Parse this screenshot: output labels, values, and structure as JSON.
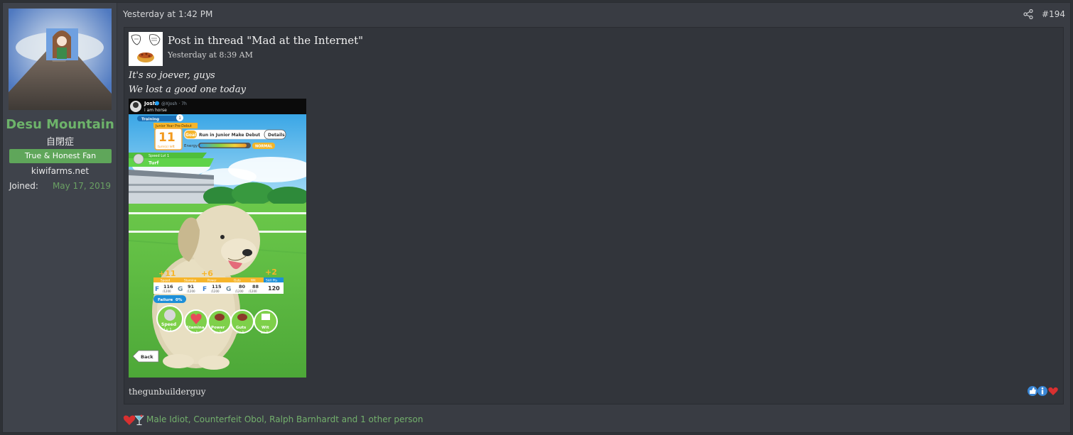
{
  "post": {
    "time": "Yesterday at 1:42 PM",
    "number": "#194",
    "share_icon": "share-icon"
  },
  "user": {
    "name": "Desu Mountain",
    "title": "自閉症",
    "banner": "True & Honest Fan",
    "site": "kiwifarms.net",
    "joined_label": "Joined:",
    "joined_value": "May 17, 2019",
    "name_color": "#6db36a",
    "banner_color": "#5fa65a"
  },
  "quote": {
    "title": "Post in thread \"Mad at the Internet\"",
    "date": "Yesterday at 8:39 AM",
    "line1": "It's so joever, guys",
    "line2": "We lost a good one today",
    "author": "thegunbuilderguy"
  },
  "screenshot": {
    "tweet_name": "Josh",
    "tweet_handle": "@XJosh · 7h",
    "tweet_text": "i am horse",
    "training_label": "Training",
    "year_label": "Junior Year Pre-Debut",
    "turns_number": "11",
    "turns_label": "turn(s) left",
    "goal_tag": "Goal",
    "goal_text": "Run in Junior Make Debut",
    "details_label": "Details",
    "energy_label": "Energy",
    "mood_label": "NORMAL",
    "speed_lvl": "Speed Lvl 1",
    "surface": "Turf",
    "gain_speed": "+11",
    "gain_stamina": "+6",
    "gain_skill": "+2",
    "stat_labels": [
      "Speed",
      "Stamina",
      "Power",
      "Guts",
      "Wit"
    ],
    "skill_pts_label": "Skill Pts",
    "stat_grades": [
      "F",
      "G",
      "F",
      "G"
    ],
    "stat_values": [
      "116",
      "91",
      "115",
      "80",
      "88"
    ],
    "stat_max": "/1200",
    "skill_pts": "120",
    "failure_label": "Failure",
    "failure_value": "0%",
    "buttons": [
      "Speed",
      "Stamina",
      "Power",
      "Guts",
      "Wit"
    ],
    "button_lv": "Lv 1",
    "back_label": "Back"
  },
  "reactions": {
    "text": "Male Idiot, Counterfeit Obol, Ralph Barnhardt and 1 other person",
    "icons": [
      "heart-icon",
      "cocktail-icon"
    ],
    "quote_icons": [
      "like-icon",
      "informative-icon",
      "heart-icon"
    ]
  }
}
